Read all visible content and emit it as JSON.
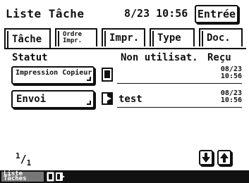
{
  "header": {
    "title": "Liste Tâche",
    "datetime": "8/23 10:56",
    "entree_label": "Entrée"
  },
  "tabs": [
    {
      "label": "Tâche",
      "active": true
    },
    {
      "label": "Ordre Impr.",
      "active": false
    },
    {
      "label": "Impr.",
      "active": false
    },
    {
      "label": "Type",
      "active": false
    },
    {
      "label": "Doc.",
      "active": false
    }
  ],
  "columns": {
    "statut": "Statut",
    "non_utilisat": "Non utilisat.",
    "recu": "Reçu"
  },
  "jobs": [
    {
      "status": "Impression Copieur",
      "icon": "document-icon",
      "name": "",
      "recu_date": "08/23",
      "recu_time": "10:56"
    },
    {
      "status": "Envoi",
      "icon": "send-document-icon",
      "name": "test",
      "recu_date": "08/23",
      "recu_time": "10:56"
    }
  ],
  "pagination": {
    "current": "1",
    "total": "1"
  },
  "taskbar": {
    "label": "Liste Tâches"
  }
}
